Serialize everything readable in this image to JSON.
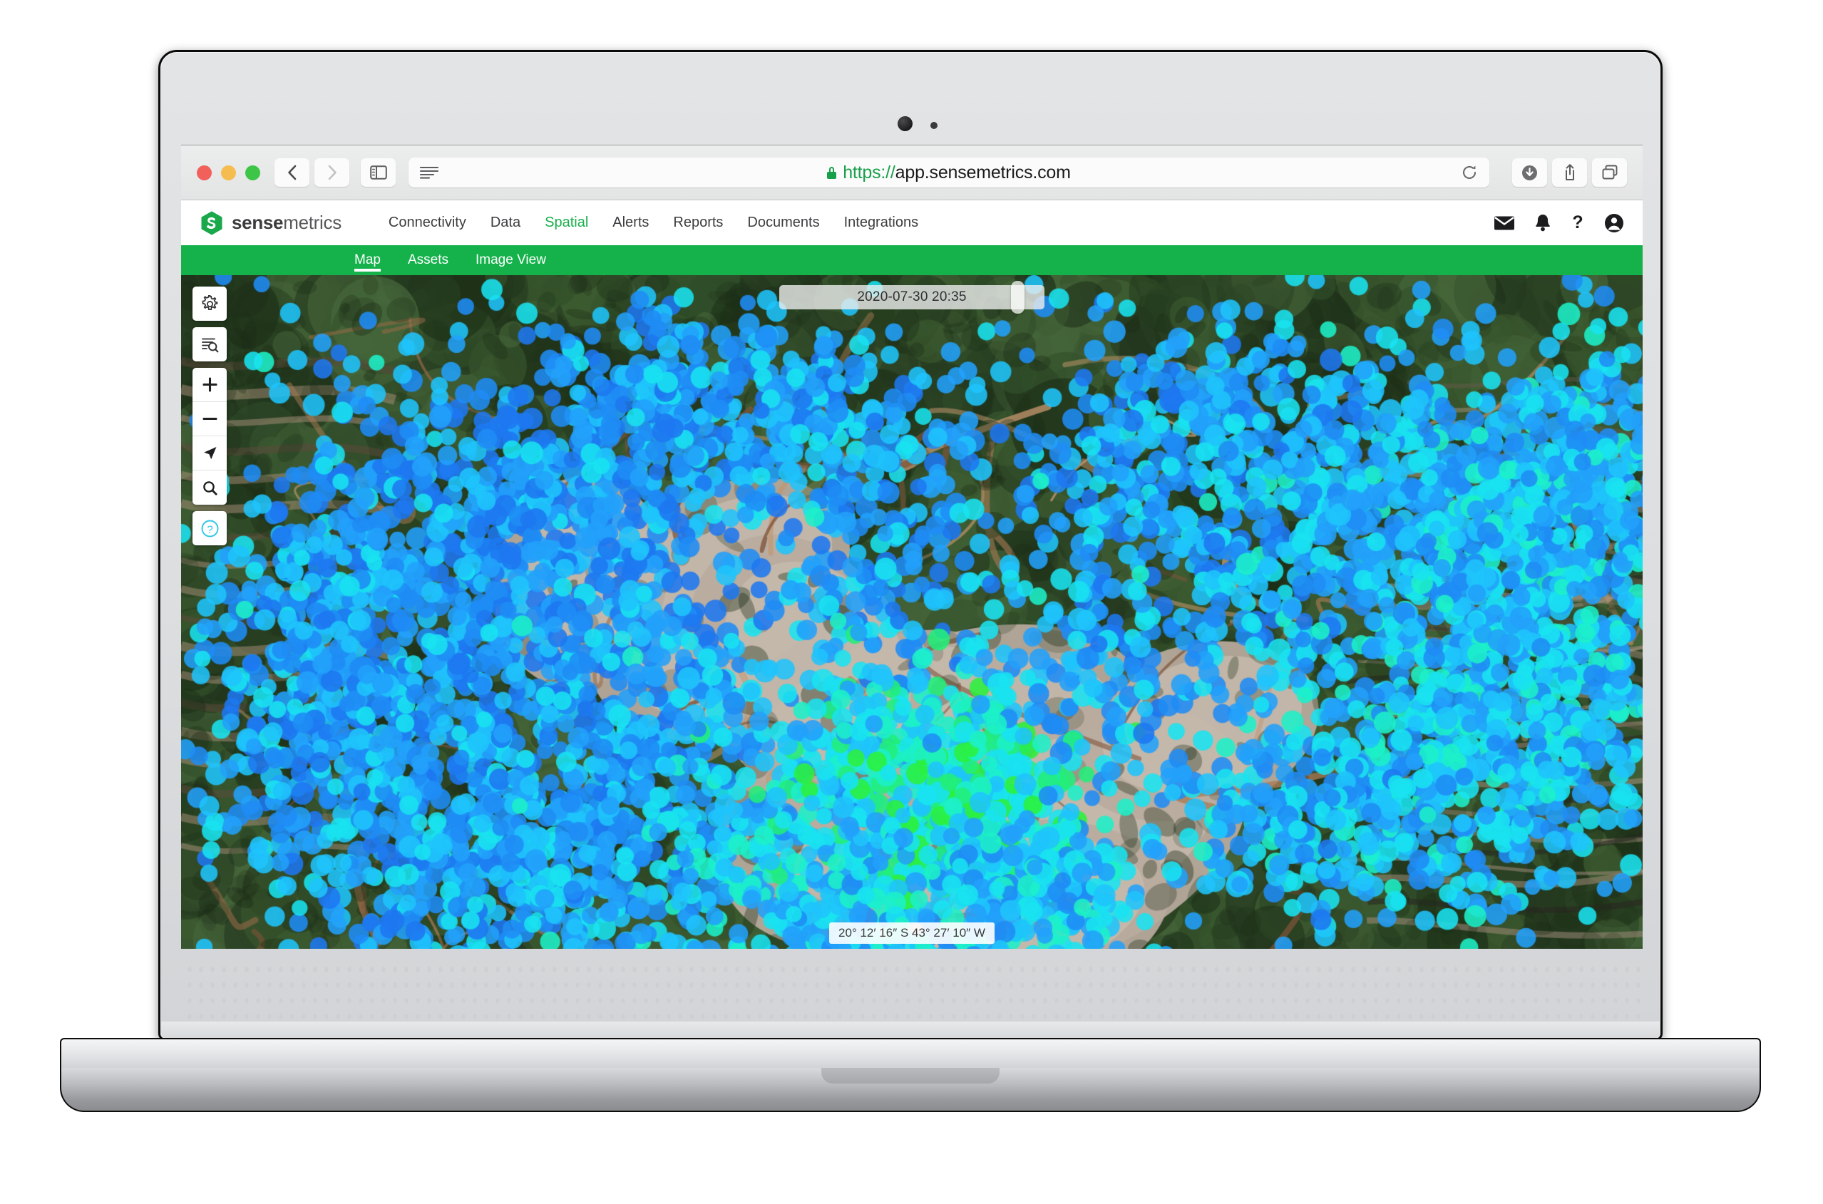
{
  "browser": {
    "url_scheme": "https://",
    "url_host": "app.sensemetrics.com",
    "traffic_lights": [
      "close",
      "minimize",
      "maximize"
    ],
    "back_label": "Back",
    "forward_label": "Forward",
    "sidebar_label": "Show Sidebar",
    "reader_label": "Reader View",
    "reload_label": "Reload",
    "downloads_label": "Downloads",
    "share_label": "Share",
    "tabs_label": "Show Tab Overview"
  },
  "app": {
    "brand_bold": "sense",
    "brand_light": "metrics",
    "nav": [
      {
        "label": "Connectivity",
        "active": false
      },
      {
        "label": "Data",
        "active": false
      },
      {
        "label": "Spatial",
        "active": true
      },
      {
        "label": "Alerts",
        "active": false
      },
      {
        "label": "Reports",
        "active": false
      },
      {
        "label": "Documents",
        "active": false
      },
      {
        "label": "Integrations",
        "active": false
      }
    ],
    "header_icons": [
      {
        "name": "mail-icon",
        "label": "Messages"
      },
      {
        "name": "bell-icon",
        "label": "Notifications"
      },
      {
        "name": "help-icon",
        "label": "Help"
      },
      {
        "name": "account-icon",
        "label": "Account"
      }
    ],
    "accent_green": "#15b24b",
    "active_nav_green": "#16b04a"
  },
  "subnav": {
    "items": [
      {
        "label": "Map",
        "active": true
      },
      {
        "label": "Assets",
        "active": false
      },
      {
        "label": "Image View",
        "active": false
      }
    ]
  },
  "map": {
    "tools": [
      {
        "name": "settings-gear-icon",
        "label": "Map Settings"
      },
      {
        "name": "layer-search-icon",
        "label": "Search Layers"
      },
      {
        "name": "zoom-in-icon",
        "label": "Zoom In"
      },
      {
        "name": "zoom-out-icon",
        "label": "Zoom Out"
      },
      {
        "name": "locate-icon",
        "label": "My Location"
      },
      {
        "name": "search-icon",
        "label": "Search"
      },
      {
        "name": "help-circle-icon",
        "label": "Help"
      }
    ],
    "timeline_value": "2020-07-30 20:35",
    "coordinates": "20° 12′ 16″ S  43° 27′ 10″ W",
    "marker_colors": [
      "#1e78f0",
      "#1f8cf5",
      "#22a0fb",
      "#1fc4fc",
      "#19e3f0",
      "#1df0c8",
      "#22ee7a",
      "#2bf03c"
    ],
    "help_icon_color": "#2ec6e6"
  }
}
